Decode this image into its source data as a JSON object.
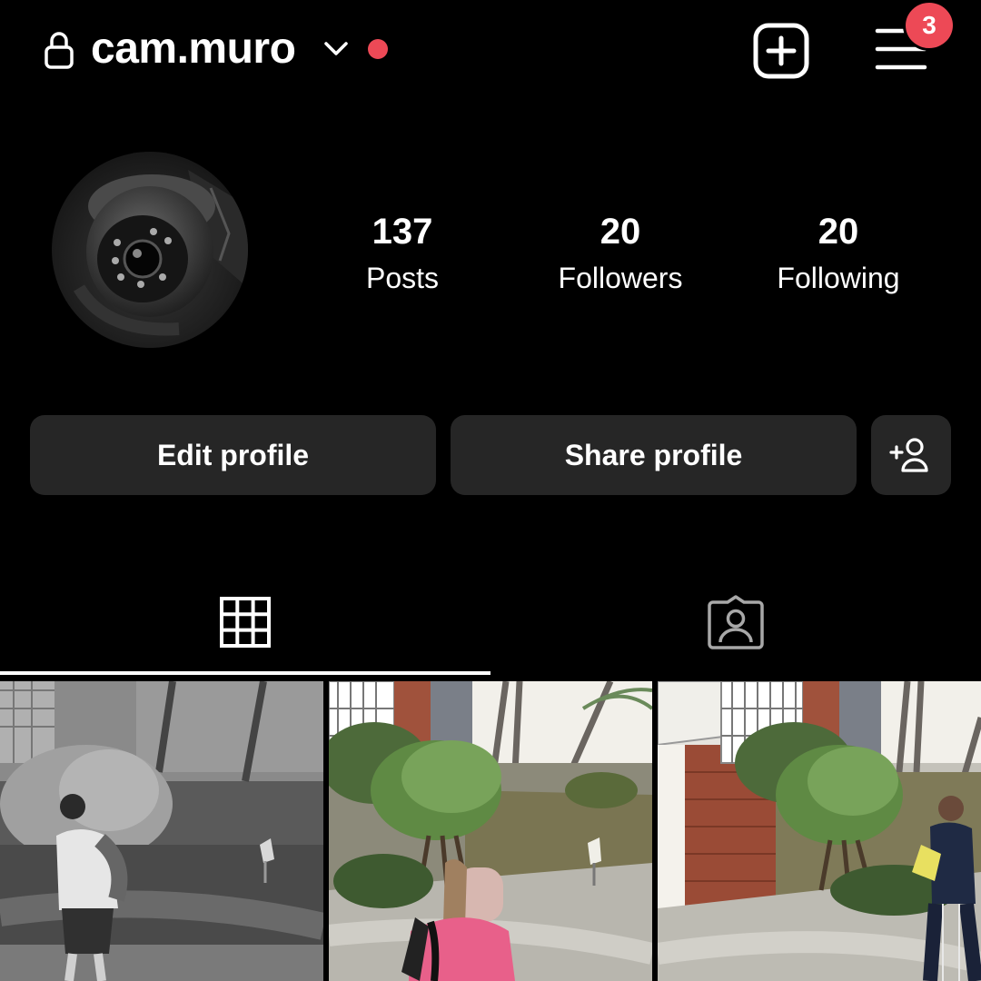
{
  "header": {
    "username": "cam.muro",
    "notification_count": "3",
    "icons": [
      "lock-icon",
      "chevron-down-icon",
      "create-post-icon",
      "menu-icon"
    ],
    "colors": {
      "notification_dot": "#ed4956",
      "badge": "#ed4956"
    }
  },
  "profile": {
    "stats": [
      {
        "value": "137",
        "label": "Posts"
      },
      {
        "value": "20",
        "label": "Followers"
      },
      {
        "value": "20",
        "label": "Following"
      }
    ],
    "buttons": {
      "edit": "Edit profile",
      "share": "Share profile"
    }
  },
  "tabs": [
    {
      "icon": "grid-icon",
      "active": true
    },
    {
      "icon": "tagged-photos-icon",
      "active": false
    }
  ],
  "posts": [
    {
      "description": "night-security-camera-thumbnail"
    },
    {
      "description": "daytime-garden-camera-thumbnail"
    },
    {
      "description": "daytime-garden-camera-thumbnail-2"
    }
  ]
}
